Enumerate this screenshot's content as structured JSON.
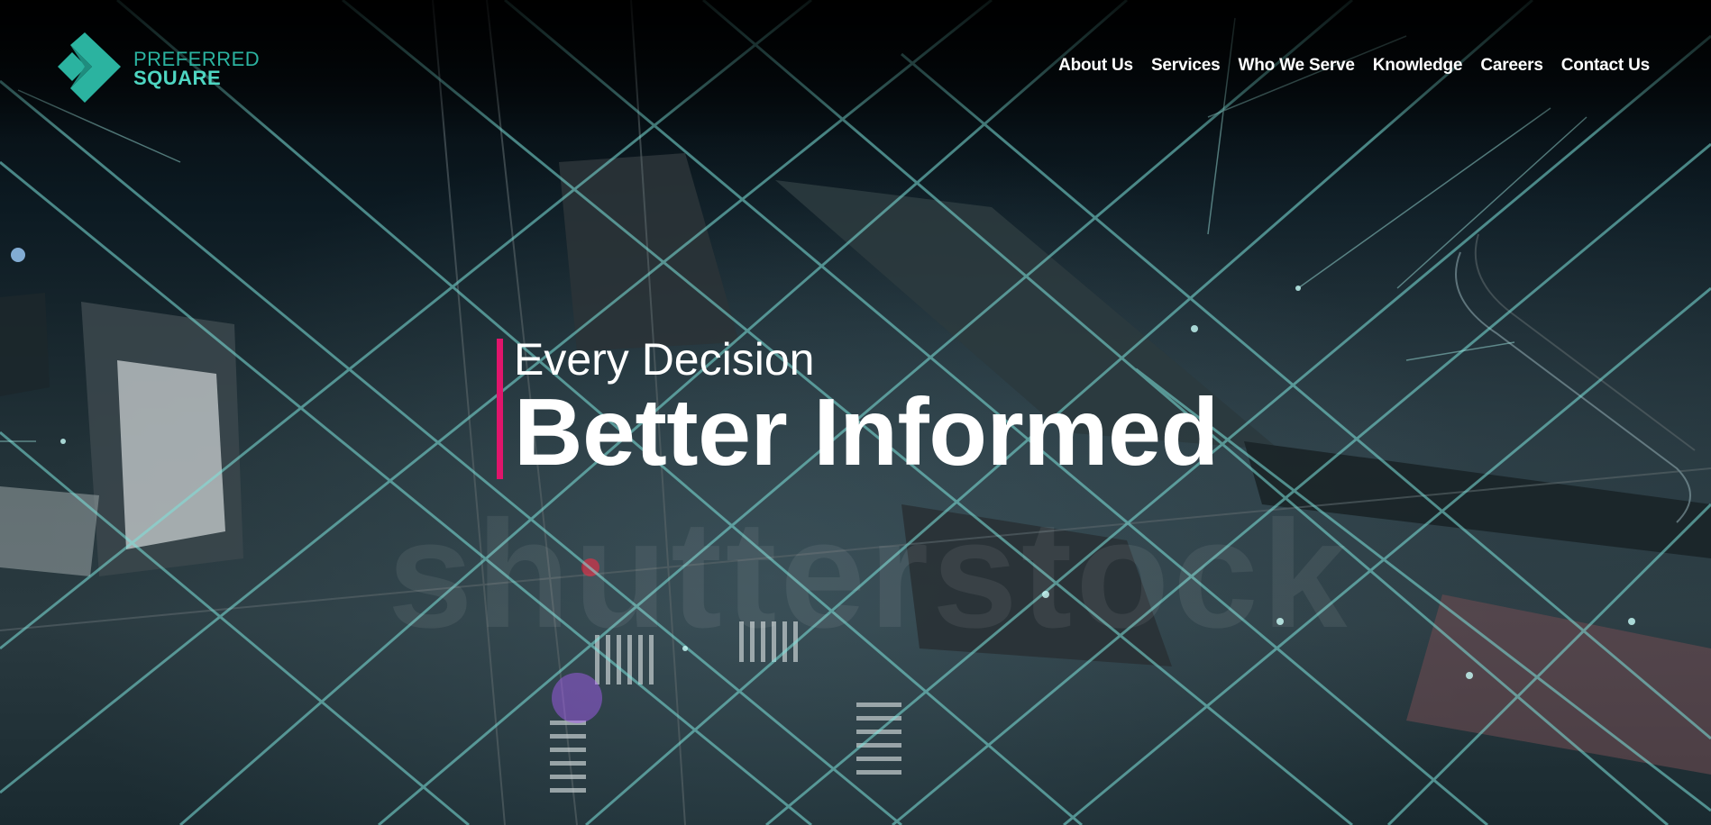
{
  "brand": {
    "line1": "PREFERRED",
    "line2": "SQUARE",
    "mark_icon": "chevron-square-logo-icon"
  },
  "nav": {
    "items": [
      {
        "label": "About Us"
      },
      {
        "label": "Services"
      },
      {
        "label": "Who We Serve"
      },
      {
        "label": "Knowledge"
      },
      {
        "label": "Careers"
      },
      {
        "label": "Contact Us"
      }
    ]
  },
  "hero": {
    "tagline_small": "Every Decision",
    "tagline_large": "Better Informed",
    "watermark": "shutterstock"
  },
  "colors": {
    "accent_bar": "#e0156b",
    "logo_teal": "#2bb3a0",
    "logo_teal_light": "#4ed6c2",
    "nav_text": "#ffffff",
    "network_lines": "#7fe3dd"
  }
}
